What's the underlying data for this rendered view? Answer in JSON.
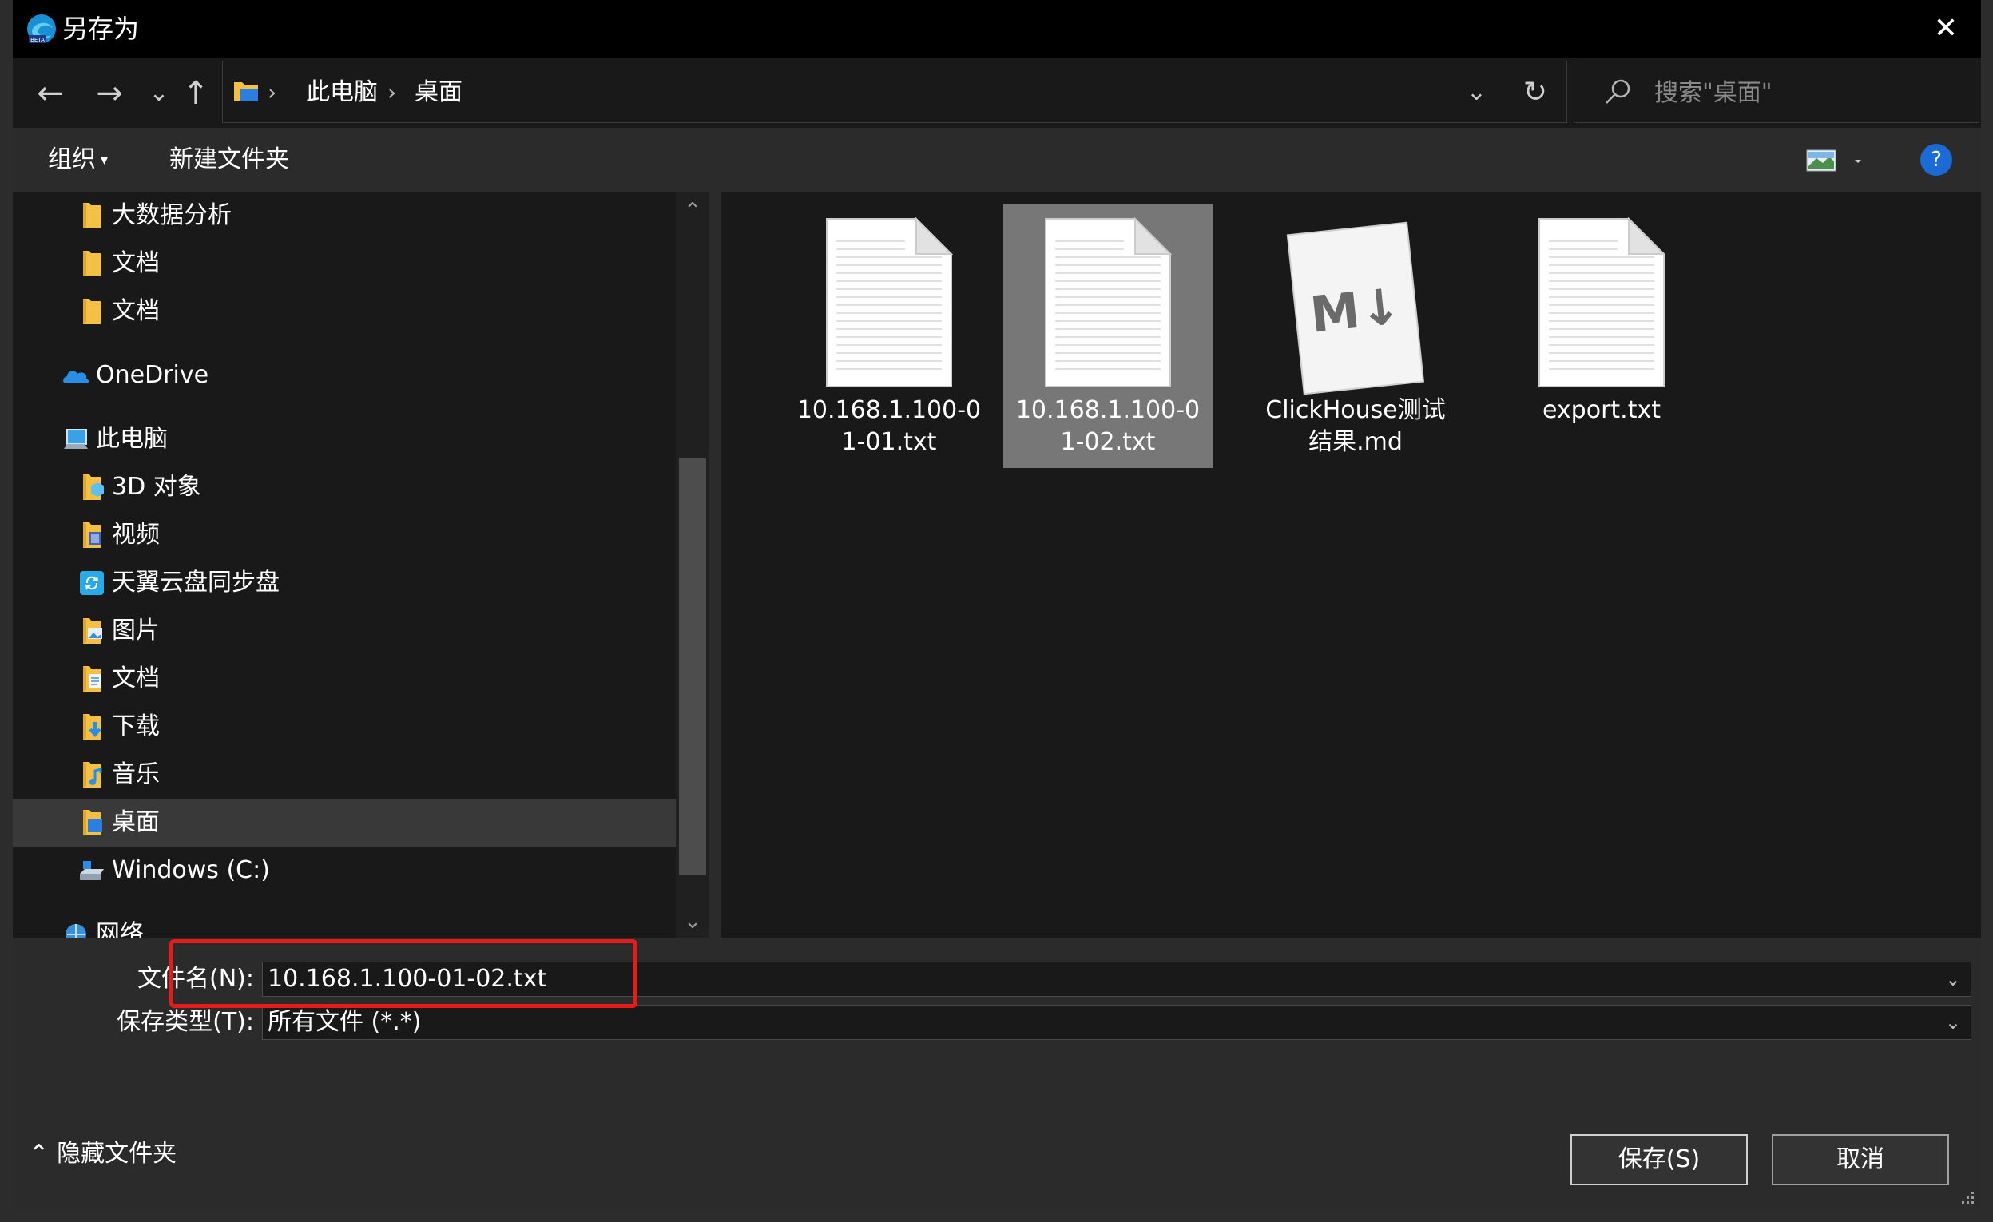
{
  "window": {
    "title": "另存为",
    "close_label": "✕"
  },
  "nav": {
    "back_label": "←",
    "forward_label": "→",
    "recent_label": "⌄",
    "up_label": "↑",
    "breadcrumb": [
      "此电脑",
      "桌面"
    ],
    "dropdown_label": "⌄",
    "refresh_label": "↻",
    "search_placeholder": "搜索\"桌面\""
  },
  "toolbar": {
    "organize_label": "组织",
    "organize_caret": "▾",
    "new_folder_label": "新建文件夹",
    "help_label": "?"
  },
  "tree": {
    "items": [
      {
        "label": "大数据分析",
        "icon": "folder-icon"
      },
      {
        "label": "文档",
        "icon": "folder-icon"
      },
      {
        "label": "文档",
        "icon": "folder-icon"
      },
      {
        "label": "OneDrive",
        "icon": "onedrive-cloud-icon"
      },
      {
        "label": "此电脑",
        "icon": "computer-icon"
      },
      {
        "label": "3D 对象",
        "icon": "3d-objects-folder-icon"
      },
      {
        "label": "视频",
        "icon": "videos-folder-icon"
      },
      {
        "label": "天翼云盘同步盘",
        "icon": "sync-disk-icon"
      },
      {
        "label": "图片",
        "icon": "pictures-folder-icon"
      },
      {
        "label": "文档",
        "icon": "documents-folder-icon"
      },
      {
        "label": "下载",
        "icon": "downloads-folder-icon"
      },
      {
        "label": "音乐",
        "icon": "music-folder-icon"
      },
      {
        "label": "桌面",
        "icon": "desktop-folder-icon",
        "selected": true
      },
      {
        "label": "Windows (C:)",
        "icon": "drive-icon"
      },
      {
        "label": "网络",
        "icon": "network-icon"
      }
    ],
    "scroll_up": "⌃",
    "scroll_down": "⌄"
  },
  "files": [
    {
      "name": "10.168.1.100-01-01.txt",
      "icon": "text-file-icon",
      "selected": false
    },
    {
      "name": "10.168.1.100-01-02.txt",
      "icon": "text-file-icon",
      "selected": true
    },
    {
      "name": "ClickHouse测试结果.md",
      "icon": "markdown-file-icon",
      "selected": false
    },
    {
      "name": "export.txt",
      "icon": "text-file-icon",
      "selected": false
    }
  ],
  "form": {
    "filename_label": "文件名(N):",
    "filename_value": "10.168.1.100-01-02.txt",
    "filetype_label": "保存类型(T):",
    "filetype_value": "所有文件 (*.*)",
    "chevron": "⌄"
  },
  "footer": {
    "hide_folders_label": "隐藏文件夹",
    "hide_folders_caret": "⌃",
    "save_label": "保存(S)",
    "cancel_label": "取消"
  },
  "colors": {
    "highlight": "#e81b1b",
    "accent": "#1b6ad6",
    "folder": "#f3c044"
  }
}
